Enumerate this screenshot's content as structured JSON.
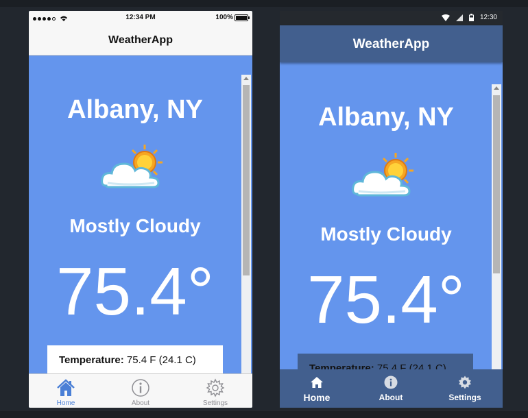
{
  "app_title": "WeatherApp",
  "ios": {
    "status": {
      "time": "12:34 PM",
      "battery": "100%"
    },
    "location": "Albany, NY",
    "condition": "Mostly Cloudy",
    "temperature": "75.4°",
    "detail": {
      "label": "Temperature:",
      "value": "75.4 F (24.1 C)"
    },
    "tabs": [
      {
        "label": "Home",
        "icon": "home-icon"
      },
      {
        "label": "About",
        "icon": "info-icon"
      },
      {
        "label": "Settings",
        "icon": "gear-icon"
      }
    ],
    "colors": {
      "accent": "#4a7fd6",
      "background": "#6495ed"
    }
  },
  "android": {
    "status": {
      "time": "12:30"
    },
    "location": "Albany, NY",
    "condition": "Mostly Cloudy",
    "temperature": "75.4°",
    "detail": {
      "label": "Temperature:",
      "value": "75.4 F (24.1 C)"
    },
    "tabs": [
      {
        "label": "Home",
        "icon": "home-icon"
      },
      {
        "label": "About",
        "icon": "info-icon"
      },
      {
        "label": "Settings",
        "icon": "gear-icon"
      }
    ],
    "colors": {
      "appbar": "#425f8e",
      "background": "#6495ed"
    }
  },
  "weather_icon": "partly-cloudy-icon"
}
